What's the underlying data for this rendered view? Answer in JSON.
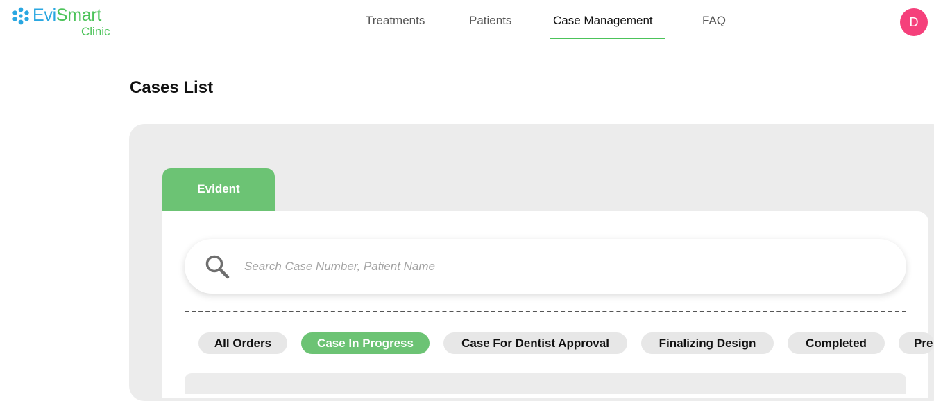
{
  "brand": {
    "name_part1": "Evi",
    "name_part2": "Smart",
    "subtitle": "Clinic",
    "colors": {
      "blue": "#2aa7e1",
      "green": "#4cc35a"
    }
  },
  "nav": {
    "items": [
      {
        "label": "Treatments",
        "active": false
      },
      {
        "label": "Patients",
        "active": false
      },
      {
        "label": "Case Management",
        "active": true
      },
      {
        "label": "FAQ",
        "active": false
      }
    ],
    "active_color": "#4cc35a"
  },
  "user": {
    "avatar_initial": "D",
    "avatar_color": "#f5407b"
  },
  "page": {
    "title": "Cases List"
  },
  "tabs": [
    {
      "label": "Evident",
      "active": true
    }
  ],
  "search": {
    "placeholder": "Search Case Number, Patient Name",
    "value": "",
    "icon": "search-icon"
  },
  "filters": {
    "items": [
      {
        "label": "All Orders",
        "active": false
      },
      {
        "label": "Case In Progress",
        "active": true
      },
      {
        "label": "Case For Dentist Approval",
        "active": false
      },
      {
        "label": "Finalizing Design",
        "active": false
      },
      {
        "label": "Completed",
        "active": false
      },
      {
        "label": "Pre",
        "active": false
      }
    ],
    "active_color": "#6cc374"
  }
}
